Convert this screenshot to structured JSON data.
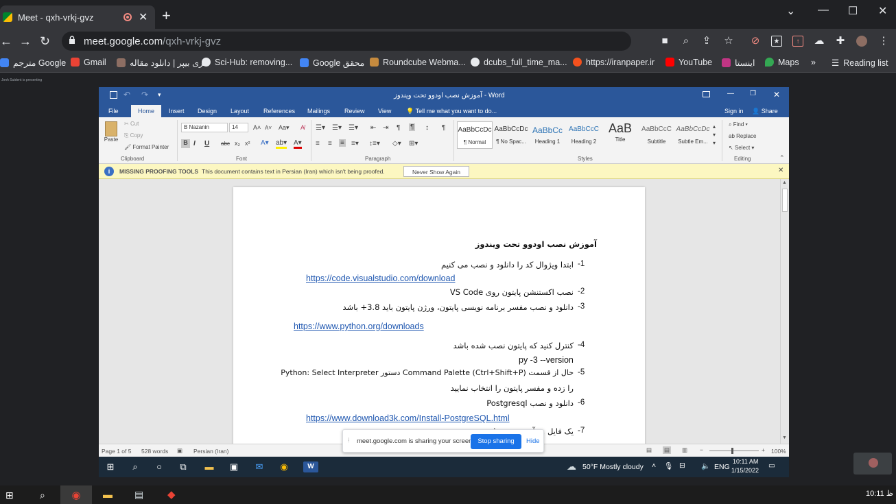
{
  "browser": {
    "tab_title": "Meet - qxh-vrkj-gvz",
    "url_host": "meet.google.com",
    "url_path": "/qxh-vrkj-gvz",
    "new_tab": "+",
    "bookmarks": [
      {
        "label": "مترجم Google",
        "icon": "google-translate-icon",
        "color": "#4285f4"
      },
      {
        "label": "Gmail",
        "icon": "gmail-icon",
        "color": "#ea4335"
      },
      {
        "label": "فری بیپر | دانلود مقاله",
        "icon": "freepaper-icon",
        "color": "#8d6e63"
      },
      {
        "label": "Sci-Hub: removing...",
        "icon": "globe-icon",
        "color": "#e8eaed"
      },
      {
        "label": "Google محقق",
        "icon": "google-scholar-icon",
        "color": "#4285f4"
      },
      {
        "label": "Roundcube Webma...",
        "icon": "roundcube-icon",
        "color": "#c58a3e"
      },
      {
        "label": "dcubs_full_time_ma...",
        "icon": "globe-icon",
        "color": "#e8eaed"
      },
      {
        "label": "https://iranpaper.ir",
        "icon": "iranpaper-icon",
        "color": "#f4511e"
      },
      {
        "label": "YouTube",
        "icon": "youtube-icon",
        "color": "#ff0000"
      },
      {
        "label": "اینستا",
        "icon": "instagram-icon",
        "color": "#c13584"
      },
      {
        "label": "Maps",
        "icon": "maps-icon",
        "color": "#34a853"
      }
    ],
    "more": "»",
    "reading_list": "Reading list"
  },
  "meet": {
    "presenting_caption": "Jonh Sutdent is presenting"
  },
  "word": {
    "title": "آموزش نصب اودوو تحت ویندوز - Word",
    "ribbon_tabs": [
      "File",
      "Home",
      "Insert",
      "Design",
      "Layout",
      "References",
      "Mailings",
      "Review",
      "View"
    ],
    "tell_me": "Tell me what you want to do...",
    "sign_in": "Sign in",
    "share": "Share",
    "clipboard": {
      "paste": "Paste",
      "cut": "Cut",
      "copy": "Copy",
      "format_painter": "Format Painter",
      "label": "Clipboard"
    },
    "font": {
      "name": "B Nazanin",
      "size": "14",
      "label": "Font"
    },
    "paragraph_label": "Paragraph",
    "styles": [
      {
        "preview": "AaBbCcDc",
        "name": "¶ Normal"
      },
      {
        "preview": "AaBbCcDc",
        "name": "¶ No Spac..."
      },
      {
        "preview": "AaBbCc",
        "name": "Heading 1"
      },
      {
        "preview": "AaBbCcC",
        "name": "Heading 2"
      },
      {
        "preview": "AaB",
        "name": "Title"
      },
      {
        "preview": "AaBbCcC",
        "name": "Subtitle"
      },
      {
        "preview": "AaBbCcDc",
        "name": "Subtle Em..."
      }
    ],
    "styles_label": "Styles",
    "editing": {
      "find": "Find",
      "replace": "Replace",
      "select": "Select",
      "label": "Editing"
    },
    "infobar": {
      "title": "MISSING PROOFING TOOLS",
      "message": "This document contains text in Persian (Iran) which isn't being proofed.",
      "button": "Never Show Again"
    },
    "document": {
      "heading": "آموزش نصب اودوو تحت ویندوز",
      "items": [
        {
          "num": "-1",
          "text": "ابتدا ویژوال کد را دانلود و نصب می کنیم"
        },
        {
          "link": "https://code.visualstudio.com/download"
        },
        {
          "num": "-2",
          "text": "نصب اکستنشن پایتون روی VS Code"
        },
        {
          "num": "-3",
          "text": "دانلود و نصب مفسر برنامه نویسی پایتون، ورژن پایتون باید 3.8+ باشد"
        },
        {
          "link": "https://www.python.org/downloads"
        },
        {
          "num": "-4",
          "text": "کنترل کنید که پایتون نصب شده باشد"
        },
        {
          "text": "py -3 --version"
        },
        {
          "num": "-5",
          "text": "حال از قسمت Command Palette (Ctrl+Shift+P) دستور Python: Select Interpreter"
        },
        {
          "text": "را زده و مفسر پایتون را انتخاب نمایید"
        },
        {
          "num": "-6",
          "text": "دانلود و نصب Postgresql"
        },
        {
          "link": "https://www.download3k.com/Install-PostgreSQL.html"
        },
        {
          "num": "-7",
          "text": "یک فایل ... آن ذخیره نمایید"
        }
      ]
    },
    "status": {
      "page": "Page 1 of 5",
      "words": "528 words",
      "language": "Persian (Iran)",
      "zoom": "100%"
    }
  },
  "share_popup": {
    "message": "meet.google.com is sharing your screen.",
    "stop": "Stop sharing",
    "hide": "Hide"
  },
  "remote_taskbar": {
    "weather": "50°F  Mostly cloudy",
    "lang": "ENG",
    "time": "10:11 AM",
    "date": "1/15/2022"
  },
  "local_taskbar": {
    "time": "10:11 ظ"
  }
}
